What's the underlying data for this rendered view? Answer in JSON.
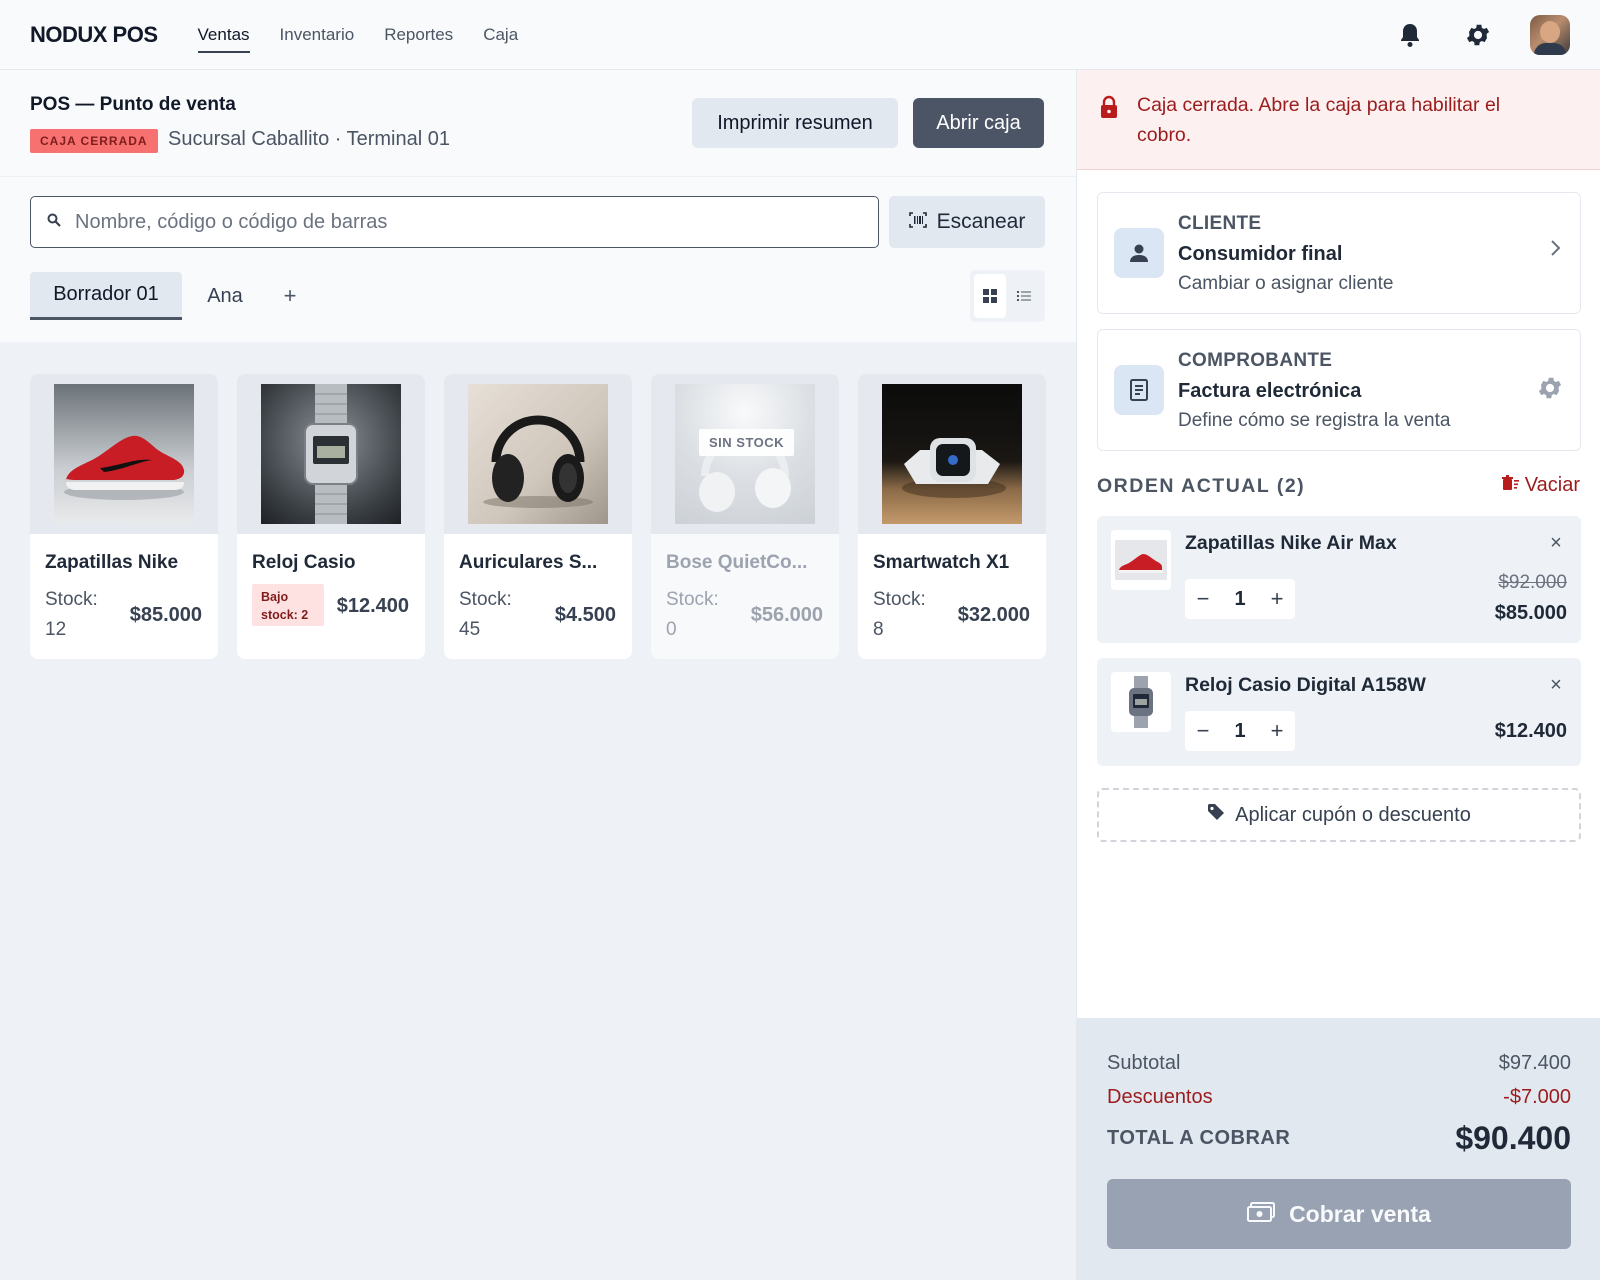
{
  "topnav": {
    "brand": "NODUX POS",
    "links": [
      "Ventas",
      "Inventario",
      "Reportes",
      "Caja"
    ],
    "active": "Ventas",
    "icons": [
      "bell-icon",
      "gear-icon",
      "avatar"
    ]
  },
  "header": {
    "title": "POS — Punto de venta",
    "status": "CAJA CERRADA",
    "branch": "Sucursal Caballito · Terminal 01",
    "print_label": "Imprimir resumen",
    "open_label": "Abrir caja"
  },
  "search": {
    "placeholder": "Nombre, código o código de barras",
    "value": "",
    "scan_label": "Escanear"
  },
  "tabs": {
    "items": [
      "Borrador 01",
      "Ana"
    ],
    "active": "Borrador 01",
    "add_label": "+"
  },
  "view": {
    "mode": "grid"
  },
  "products": [
    {
      "name": "Zapatillas Nike",
      "stock_label": "Stock:",
      "stock": "12",
      "price": "$85.000",
      "image": "red-sneaker"
    },
    {
      "name": "Reloj Casio",
      "low_badge": "Bajo stock: 2",
      "price": "$12.400",
      "image": "digital-watch"
    },
    {
      "name": "Auriculares S...",
      "stock_label": "Stock:",
      "stock": "45",
      "price": "$4.500",
      "image": "black-headphones"
    },
    {
      "name": "Bose QuietCo...",
      "stock_label": "Stock:",
      "stock": "0",
      "price": "$56.000",
      "image": "white-headphones",
      "overlay": "SIN STOCK"
    },
    {
      "name": "Smartwatch X1",
      "stock_label": "Stock:",
      "stock": "8",
      "price": "$32.000",
      "image": "smartwatch"
    }
  ],
  "alert": {
    "text": "Caja cerrada. Abre la caja para habilitar el cobro."
  },
  "customer": {
    "label": "CLIENTE",
    "value": "Consumidor final",
    "sub": "Cambiar o asignar cliente"
  },
  "receipt": {
    "label": "COMPROBANTE",
    "value": "Factura electrónica",
    "sub": "Define cómo se registra la venta"
  },
  "order": {
    "title": "ORDEN ACTUAL (2)",
    "clear_label": "Vaciar",
    "items": [
      {
        "name": "Zapatillas Nike Air Max",
        "qty": "1",
        "old_price": "$92.000",
        "price": "$85.000"
      },
      {
        "name": "Reloj Casio Digital A158W",
        "qty": "1",
        "price": "$12.400"
      }
    ]
  },
  "coupon_label": "Aplicar cupón o descuento",
  "totals": {
    "subtotal_label": "Subtotal",
    "subtotal": "$97.400",
    "discount_label": "Descuentos",
    "discount": "-$7.000",
    "total_label": "TOTAL A COBRAR",
    "total": "$90.400",
    "charge_label": "Cobrar venta"
  },
  "colors": {
    "accent": "#4b5565",
    "danger": "#9b1c1c",
    "badge": "#f87171"
  }
}
